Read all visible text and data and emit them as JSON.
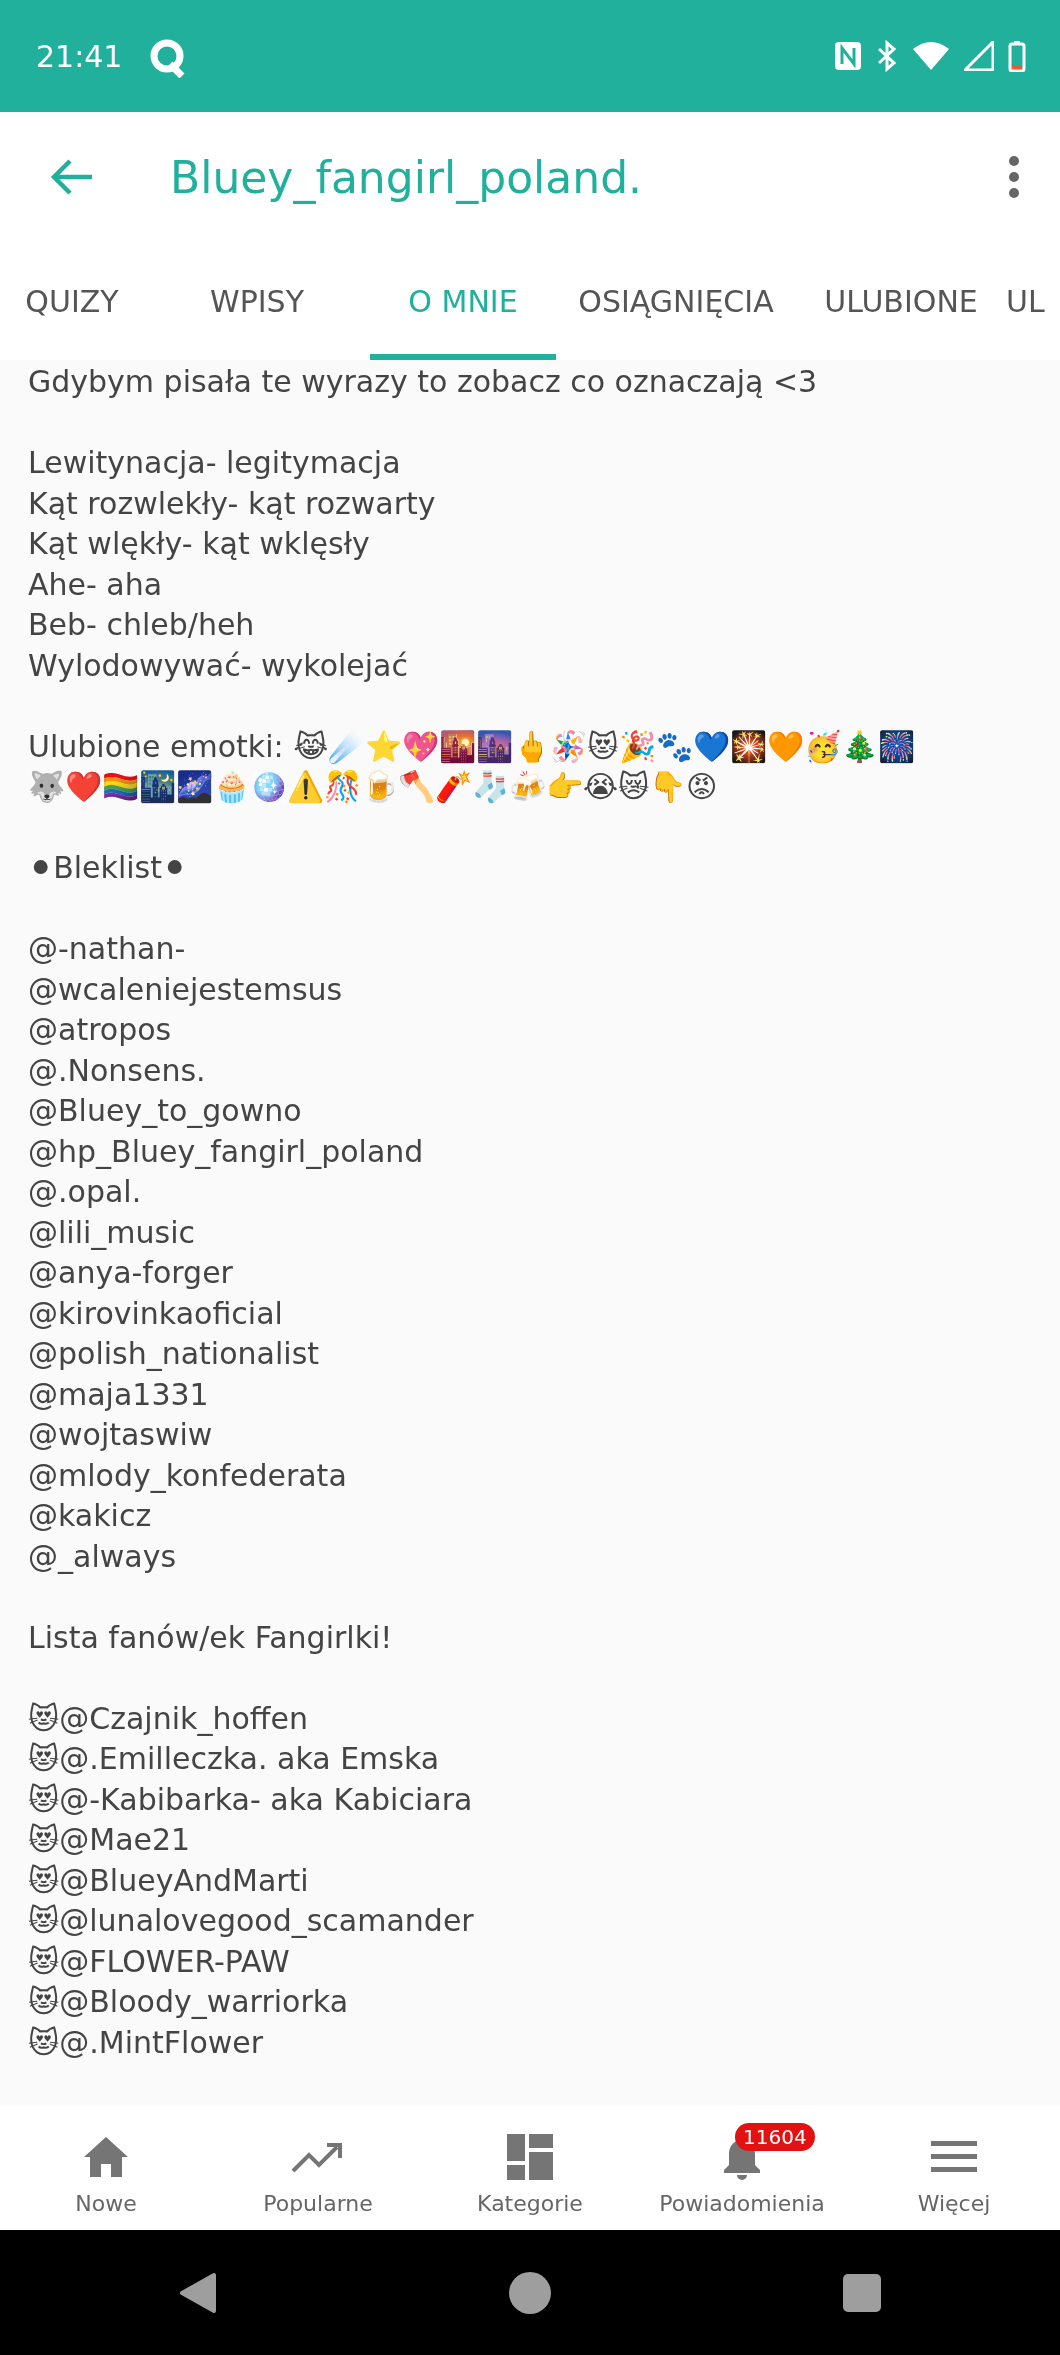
{
  "status_bar": {
    "time": "21:41"
  },
  "app_bar": {
    "title": "Bluey_fangirl_poland."
  },
  "tabs": [
    {
      "label": "QUIZY",
      "selected": false
    },
    {
      "label": "WPISY",
      "selected": false
    },
    {
      "label": "O MNIE",
      "selected": true
    },
    {
      "label": "OSIĄGNIĘCIA",
      "selected": false
    },
    {
      "label": "ULUBIONE",
      "selected": false
    },
    {
      "label": "UL",
      "selected": false
    }
  ],
  "content": [
    [
      "Gdybym pisała te wyrazy to zobacz co oznaczają <3"
    ],
    [
      "Lewitynacja- legitymacja",
      "Kąt rozwlekły- kąt rozwarty",
      "Kąt wlękły- kąt wklęsły",
      "Ahe- aha",
      "Beb- chleb/heh",
      "Wylodowywać- wykolejać"
    ],
    [
      "Ulubione emotki: 😹☄️⭐💖🌇🌆🖕🪅😻🎉🐾💙🎇🧡🥳🎄🎆",
      "🐺❤️🏳️‍🌈🌃🌌🧁🪩⚠️🎊🍺🪓🧨🧦🍻👉😭😿👇😡"
    ],
    [
      "⚫Bleklist⚫"
    ],
    [
      "@-nathan-",
      "@wcaleniejestemsus",
      "@atropos",
      "@.Nonsens.",
      "@Bluey_to_gowno",
      "@hp_Bluey_fangirl_poland",
      "@.opal.",
      "@lili_music",
      "@anya-forger",
      "@kirovinkaoficial",
      "@polish_nationalist",
      "@maja1331",
      "@wojtaswiw",
      "@mlody_konfederata",
      "@kakicz",
      "@_always"
    ],
    [
      "Lista fanów/ek Fangirlki!"
    ],
    [
      "😻@Czajnik_hoffen",
      "😻@.Emilleczka. aka Emska",
      "😻@-Kabibarka-  aka Kabiciara",
      "😻@Mae21",
      "😻@BlueyAndMarti",
      "😻@lunalovegood_scamander",
      "😻@FLOWER-PAW",
      "😻@Bloody_warriorka",
      "😻@.MintFlower"
    ]
  ],
  "bottom_nav": [
    {
      "label": "Nowe",
      "kind": "home"
    },
    {
      "label": "Popularne",
      "kind": "trend"
    },
    {
      "label": "Kategorie",
      "kind": "grid"
    },
    {
      "label": "Powiadomienia",
      "kind": "bell",
      "badge": "11604"
    },
    {
      "label": "Więcej",
      "kind": "menu"
    }
  ]
}
